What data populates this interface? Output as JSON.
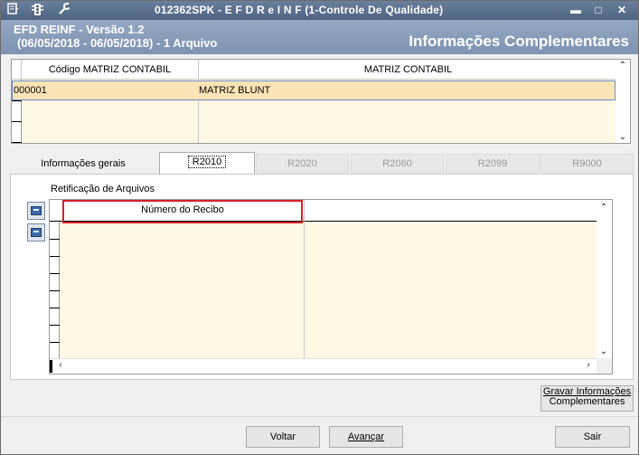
{
  "titlebar": {
    "title": "012362SPK - E F D   R e I N F (1-Controle De Qualidade)",
    "icons": [
      "menu-icon",
      "traffic-light-icon",
      "wrench-icon"
    ],
    "minimize": "▬",
    "maximize": "□",
    "close": "✕"
  },
  "banner": {
    "line1": "EFD REINF - Versão 1.2",
    "line2": "(06/05/2018 - 06/05/2018) - 1 Arquivo",
    "section_title": "Informações Complementares"
  },
  "matrix_grid": {
    "columns": [
      "Código MATRIZ CONTABIL",
      "MATRIZ CONTABIL"
    ],
    "rows": [
      {
        "code": "000001",
        "name": "MATRIZ BLUNT"
      }
    ]
  },
  "tabs": [
    {
      "label": "Informações gerais",
      "state": "normal"
    },
    {
      "label": "R2010",
      "state": "active"
    },
    {
      "label": "R2020",
      "state": "disabled"
    },
    {
      "label": "R2060",
      "state": "disabled"
    },
    {
      "label": "R2099",
      "state": "disabled"
    },
    {
      "label": "R9000",
      "state": "disabled"
    }
  ],
  "panel": {
    "caption": "Retificação de Arquivos",
    "side_buttons": [
      "monitor-icon",
      "monitor-icon"
    ],
    "grid_columns": [
      "Número do Recibo",
      ""
    ]
  },
  "buttons": {
    "save_line1": "Gravar Informações",
    "save_line2": "Complementares",
    "back": "Voltar",
    "next": "Avançar",
    "exit": "Sair"
  },
  "colors": {
    "titlebar": "#5a6f8c",
    "banner": "#8a9eba",
    "grid_body": "#fff8e4",
    "selected_row": "#fde4b6",
    "highlight_border": "#d4202a"
  }
}
